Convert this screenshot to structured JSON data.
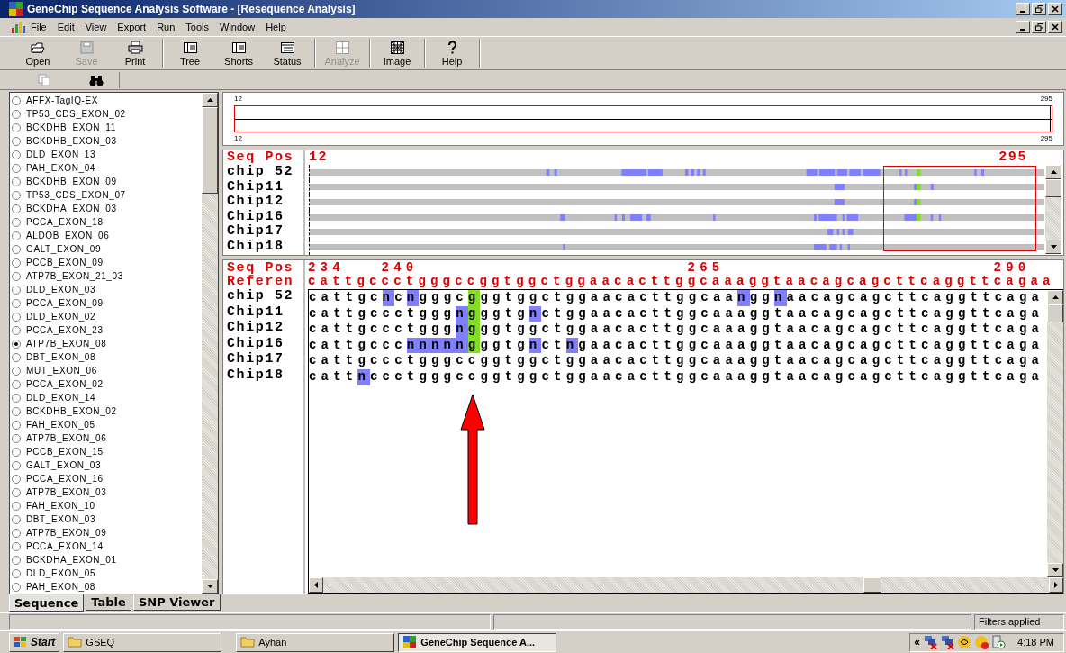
{
  "window": {
    "title": "GeneChip Sequence Analysis Software - [Resequence Analysis]"
  },
  "menu": [
    "File",
    "Edit",
    "View",
    "Export",
    "Run",
    "Tools",
    "Window",
    "Help"
  ],
  "toolbar": [
    [
      {
        "label": "Open",
        "disabled": false
      },
      {
        "label": "Save",
        "disabled": true
      },
      {
        "label": "Print",
        "disabled": false
      }
    ],
    [
      {
        "label": "Tree",
        "disabled": false
      },
      {
        "label": "Shorts",
        "disabled": false
      },
      {
        "label": "Status",
        "disabled": false
      }
    ],
    [
      {
        "label": "Analyze",
        "disabled": true
      }
    ],
    [
      {
        "label": "Image",
        "disabled": false
      }
    ],
    [
      {
        "label": "Help",
        "disabled": false
      }
    ]
  ],
  "exon_list": {
    "items": [
      {
        "label": "AFFX-TagIQ-EX",
        "selected": false
      },
      {
        "label": "TP53_CDS_EXON_02",
        "selected": false
      },
      {
        "label": "BCKDHB_EXON_11",
        "selected": false
      },
      {
        "label": "BCKDHB_EXON_03",
        "selected": false
      },
      {
        "label": "DLD_EXON_13",
        "selected": false
      },
      {
        "label": "PAH_EXON_04",
        "selected": false
      },
      {
        "label": "BCKDHB_EXON_09",
        "selected": false
      },
      {
        "label": "TP53_CDS_EXON_07",
        "selected": false
      },
      {
        "label": "BCKDHA_EXON_03",
        "selected": false
      },
      {
        "label": "PCCA_EXON_18",
        "selected": false
      },
      {
        "label": "ALDOB_EXON_06",
        "selected": false
      },
      {
        "label": "GALT_EXON_09",
        "selected": false
      },
      {
        "label": "PCCB_EXON_09",
        "selected": false
      },
      {
        "label": "ATP7B_EXON_21_03",
        "selected": false
      },
      {
        "label": "DLD_EXON_03",
        "selected": false
      },
      {
        "label": "PCCA_EXON_09",
        "selected": false
      },
      {
        "label": "DLD_EXON_02",
        "selected": false
      },
      {
        "label": "PCCA_EXON_23",
        "selected": false
      },
      {
        "label": "ATP7B_EXON_08",
        "selected": true
      },
      {
        "label": "DBT_EXON_08",
        "selected": false
      },
      {
        "label": "MUT_EXON_06",
        "selected": false
      },
      {
        "label": "PCCA_EXON_02",
        "selected": false
      },
      {
        "label": "DLD_EXON_14",
        "selected": false
      },
      {
        "label": "BCKDHB_EXON_02",
        "selected": false
      },
      {
        "label": "FAH_EXON_05",
        "selected": false
      },
      {
        "label": "ATP7B_EXON_06",
        "selected": false
      },
      {
        "label": "PCCB_EXON_15",
        "selected": false
      },
      {
        "label": "GALT_EXON_03",
        "selected": false
      },
      {
        "label": "PCCA_EXON_16",
        "selected": false
      },
      {
        "label": "ATP7B_EXON_03",
        "selected": false
      },
      {
        "label": "FAH_EXON_10",
        "selected": false
      },
      {
        "label": "DBT_EXON_03",
        "selected": false
      },
      {
        "label": "ATP7B_EXON_09",
        "selected": false
      },
      {
        "label": "PCCA_EXON_14",
        "selected": false
      },
      {
        "label": "BCKDHA_EXON_01",
        "selected": false
      },
      {
        "label": "DLD_EXON_05",
        "selected": false
      },
      {
        "label": "PAH_EXON_08",
        "selected": false
      }
    ]
  },
  "tabs": [
    {
      "label": "Sequence",
      "selected": true
    },
    {
      "label": "Table",
      "selected": false
    },
    {
      "label": "SNP Viewer",
      "selected": false
    }
  ],
  "ruler": {
    "top_start": "12",
    "top_end": "295",
    "bottom_start": "12",
    "bottom_end": "295"
  },
  "overview": {
    "position_label": "Seq Pos",
    "start": "12",
    "end": "295",
    "tracks": [
      {
        "name": "chip 52"
      },
      {
        "name": "Chip11"
      },
      {
        "name": "Chip12"
      },
      {
        "name": "Chip16"
      },
      {
        "name": "Chip17"
      },
      {
        "name": "Chip18"
      }
    ]
  },
  "alignment": {
    "position_label": "Seq Pos",
    "ticks": [
      "234",
      "240",
      "265",
      "290"
    ],
    "reference": {
      "label": "Referen",
      "sequence": "cattgccctgggccggtggctggaacacttggcaaaggtaacagcagcttcaggttcagaa"
    },
    "rows": [
      {
        "name": "chip 52",
        "segments": [
          {
            "text": "cattgc"
          },
          {
            "text": "n",
            "color": "#8080ff"
          },
          {
            "text": "c"
          },
          {
            "text": "n",
            "color": "#8080ff"
          },
          {
            "text": "gggc"
          },
          {
            "text": "g",
            "color": "#80e020"
          },
          {
            "text": "ggtggctggaacacttggcaa"
          },
          {
            "text": "n",
            "color": "#8080ff"
          },
          {
            "text": "gg"
          },
          {
            "text": "n",
            "color": "#8080ff"
          },
          {
            "text": "aacagcagcttcaggttcaga"
          }
        ]
      },
      {
        "name": "Chip11",
        "segments": [
          {
            "text": "cattgccctggg"
          },
          {
            "text": "n",
            "color": "#8080ff"
          },
          {
            "text": "g",
            "color": "#80e020"
          },
          {
            "text": "ggtg"
          },
          {
            "text": "n",
            "color": "#8080ff"
          },
          {
            "text": "ctggaacacttggcaaaggtaacagcagcttcaggttcaga"
          }
        ]
      },
      {
        "name": "Chip12",
        "segments": [
          {
            "text": "cattgccctggg"
          },
          {
            "text": "n",
            "color": "#8080ff"
          },
          {
            "text": "g",
            "color": "#80e020"
          },
          {
            "text": "ggtggctggaacacttggcaaaggtaacagcagcttcaggttcaga"
          }
        ]
      },
      {
        "name": "Chip16",
        "segments": [
          {
            "text": "cattgccc"
          },
          {
            "text": "nnnnn",
            "color": "#8080ff"
          },
          {
            "text": "g",
            "color": "#80e020"
          },
          {
            "text": "ggtg"
          },
          {
            "text": "n",
            "color": "#8080ff"
          },
          {
            "text": "ct"
          },
          {
            "text": "n",
            "color": "#8080ff"
          },
          {
            "text": "gaacacttggcaaaggtaacagcagcttcaggttcaga"
          }
        ]
      },
      {
        "name": "Chip17",
        "segments": [
          {
            "text": "cattgccctgggccggtggctggaacacttggcaaaggtaacagcagcttcaggttcaga"
          }
        ]
      },
      {
        "name": "Chip18",
        "segments": [
          {
            "text": "catt"
          },
          {
            "text": "n",
            "color": "#8080ff"
          },
          {
            "text": "ccctgggccggtggctggaacacttggcaaaggtaacagcagcttcaggttcaga"
          }
        ]
      }
    ]
  },
  "status_bar": {
    "message": "Filters applied"
  },
  "taskbar": {
    "start": "Start",
    "tasks": [
      {
        "label": "GSEQ",
        "selected": false
      },
      {
        "label": "Ayhan",
        "selected": false
      },
      {
        "label": "GeneChip Sequence A...",
        "selected": true
      }
    ],
    "tray_chevron": "«",
    "clock": "4:18 PM"
  }
}
